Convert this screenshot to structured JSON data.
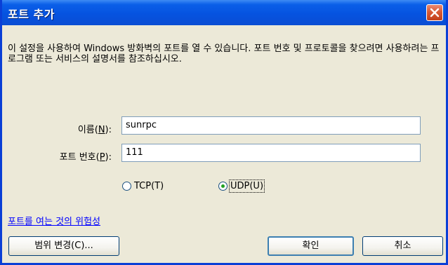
{
  "window": {
    "title": "포트 추가"
  },
  "description": "이 설정을 사용하여 Windows 방화벽의 포트를 열 수 있습니다. 포트 번호 및 프로토콜을 찾으려면 사용하려는 프로그램 또는 서비스의 설명서를 참조하십시오.",
  "form": {
    "name_label_pre": "이름(",
    "name_label_key": "N",
    "name_label_post": "):",
    "name_value": "sunrpc",
    "port_label_pre": "포트 번호(",
    "port_label_key": "P",
    "port_label_post": "):",
    "port_value": "111",
    "protocol": {
      "tcp_label": "TCP(T)",
      "udp_label": "UDP(U)",
      "selected": "UDP"
    }
  },
  "risk_link": "포트를 여는 것의 위험성",
  "buttons": {
    "change_scope": "범위 변경(C)...",
    "ok": "확인",
    "cancel": "취소"
  },
  "colors": {
    "titlebar": "#0653E0",
    "dialog_bg": "#ECE9D8",
    "link": "#0000FF",
    "radio_selected": "#21A121"
  }
}
